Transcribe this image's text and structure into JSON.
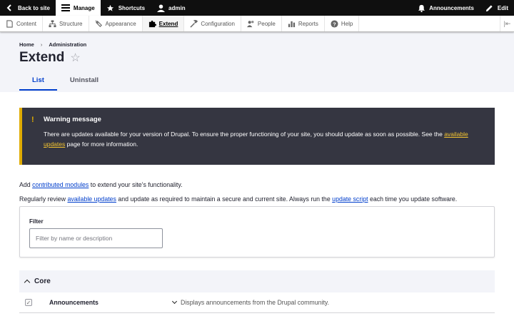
{
  "toolbar": {
    "back_to_site": "Back to site",
    "manage": "Manage",
    "shortcuts": "Shortcuts",
    "user": "admin",
    "announcements": "Announcements",
    "edit": "Edit"
  },
  "tray": {
    "items": [
      {
        "label": "Content",
        "icon": "content-icon"
      },
      {
        "label": "Structure",
        "icon": "structure-icon"
      },
      {
        "label": "Appearance",
        "icon": "appearance-icon"
      },
      {
        "label": "Extend",
        "icon": "extend-icon"
      },
      {
        "label": "Configuration",
        "icon": "configuration-icon"
      },
      {
        "label": "People",
        "icon": "people-icon"
      },
      {
        "label": "Reports",
        "icon": "reports-icon"
      },
      {
        "label": "Help",
        "icon": "help-icon"
      }
    ],
    "active": "Extend"
  },
  "breadcrumb": {
    "home": "Home",
    "sep": "›",
    "admin": "Administration"
  },
  "page": {
    "title": "Extend",
    "star": "☆",
    "tabs": [
      {
        "label": "List"
      },
      {
        "label": "Uninstall"
      }
    ]
  },
  "warning": {
    "icon": "!",
    "title": "Warning message",
    "text_before": "There are updates available for your version of Drupal. To ensure the proper functioning of your site, you should update as soon as possible. See the ",
    "link": "available updates",
    "text_after": " page for more information."
  },
  "intro": {
    "p1_before": "Add ",
    "p1_link": "contributed modules",
    "p1_after": " to extend your site’s functionality.",
    "p2_before": "Regularly review ",
    "p2_link1": "available updates",
    "p2_mid": " and update as required to maintain a secure and current site. Always run the ",
    "p2_link2": "update script",
    "p2_after": " each time you update software."
  },
  "filter": {
    "label": "Filter",
    "placeholder": "Filter by name or description"
  },
  "core": {
    "title": "Core",
    "modules": [
      {
        "name": "Announcements",
        "description": "Displays announcements from the Drupal community.",
        "checked": true
      }
    ]
  },
  "colors": {
    "accent": "#003ecc",
    "warning": "#e0ac00",
    "warning_bg": "#353641"
  }
}
